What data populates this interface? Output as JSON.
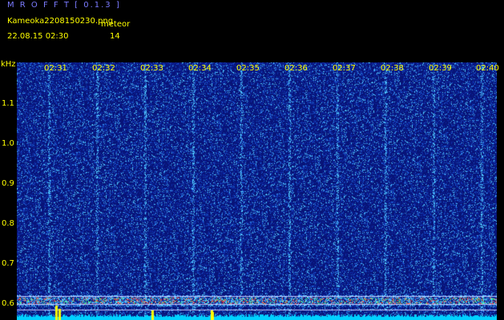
{
  "header": {
    "app_title": "M R O F F T  [ 0.1.3 ]",
    "filename": "Kameoka2208150230.png",
    "meteor_label": "meteor",
    "datetime": "22.08.15 02:30",
    "meteor_count": "14"
  },
  "axes": {
    "y_unit": "kHz",
    "x_ticks": [
      "02:31",
      "02:32",
      "02:33",
      "02:34",
      "02:35",
      "02:36",
      "02:37",
      "02:38",
      "02:39",
      "02:40"
    ],
    "y_ticks": [
      "1.1",
      "1.0",
      "0.9",
      "0.8",
      "0.7",
      "0.6"
    ]
  },
  "colors": {
    "background": "#000000",
    "text": "#ffff00",
    "title": "#7b7bff",
    "spectrogram_base": "#0a1a8a",
    "guide_lines": "#c8c8ff",
    "baseline_trace": "#00d0ff",
    "peak_trace": "#ffff00"
  }
}
